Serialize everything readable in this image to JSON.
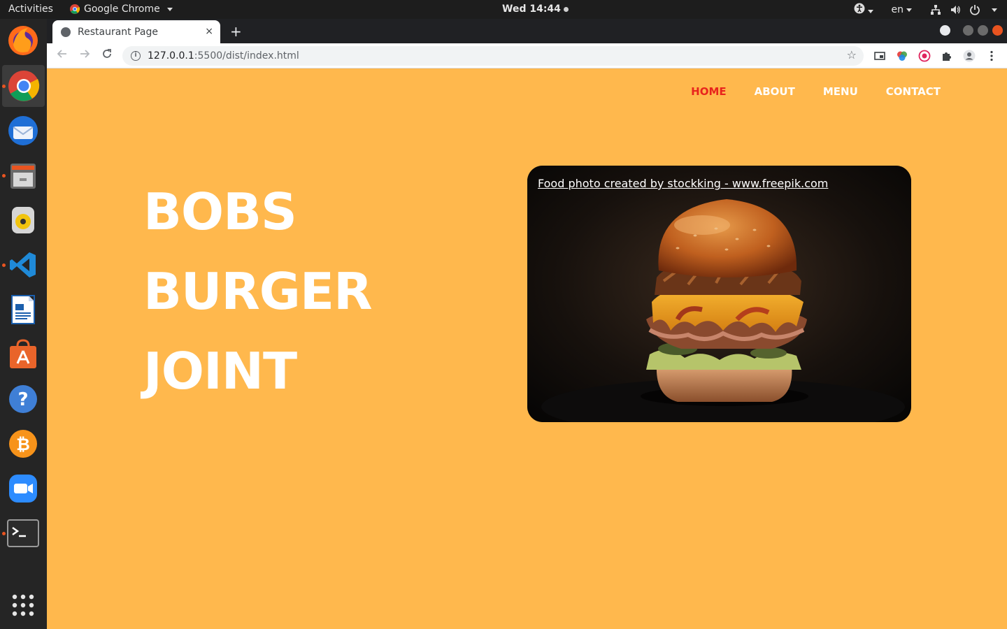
{
  "system_bar": {
    "activities": "Activities",
    "app_name": "Google Chrome",
    "clock": "Wed 14:44",
    "language": "en"
  },
  "dock": {
    "apps": [
      "firefox-icon",
      "chrome-icon",
      "thunderbird-icon",
      "files-icon",
      "rhythmbox-icon",
      "vscode-icon",
      "writer-icon",
      "software-icon",
      "help-icon",
      "bitcoin-icon",
      "zoom-icon",
      "terminal-icon",
      "app-grid-icon"
    ]
  },
  "browser": {
    "tab_title": "Restaurant Page",
    "url_host": "127.0.0.1",
    "url_path": ":5500/dist/index.html",
    "new_tab": "+",
    "close_tab": "×"
  },
  "site": {
    "nav": {
      "home": "HOME",
      "about": "ABOUT",
      "menu": "MENU",
      "contact": "CONTACT"
    },
    "hero": {
      "line1": "BOBS",
      "line2": "BURGER",
      "line3": "JOINT"
    },
    "photo_credit": "Food photo created by stockking - www.freepik.com"
  },
  "colors": {
    "page_bg": "#ffb84d",
    "nav_active": "#e8241d",
    "text": "#ffffff"
  }
}
